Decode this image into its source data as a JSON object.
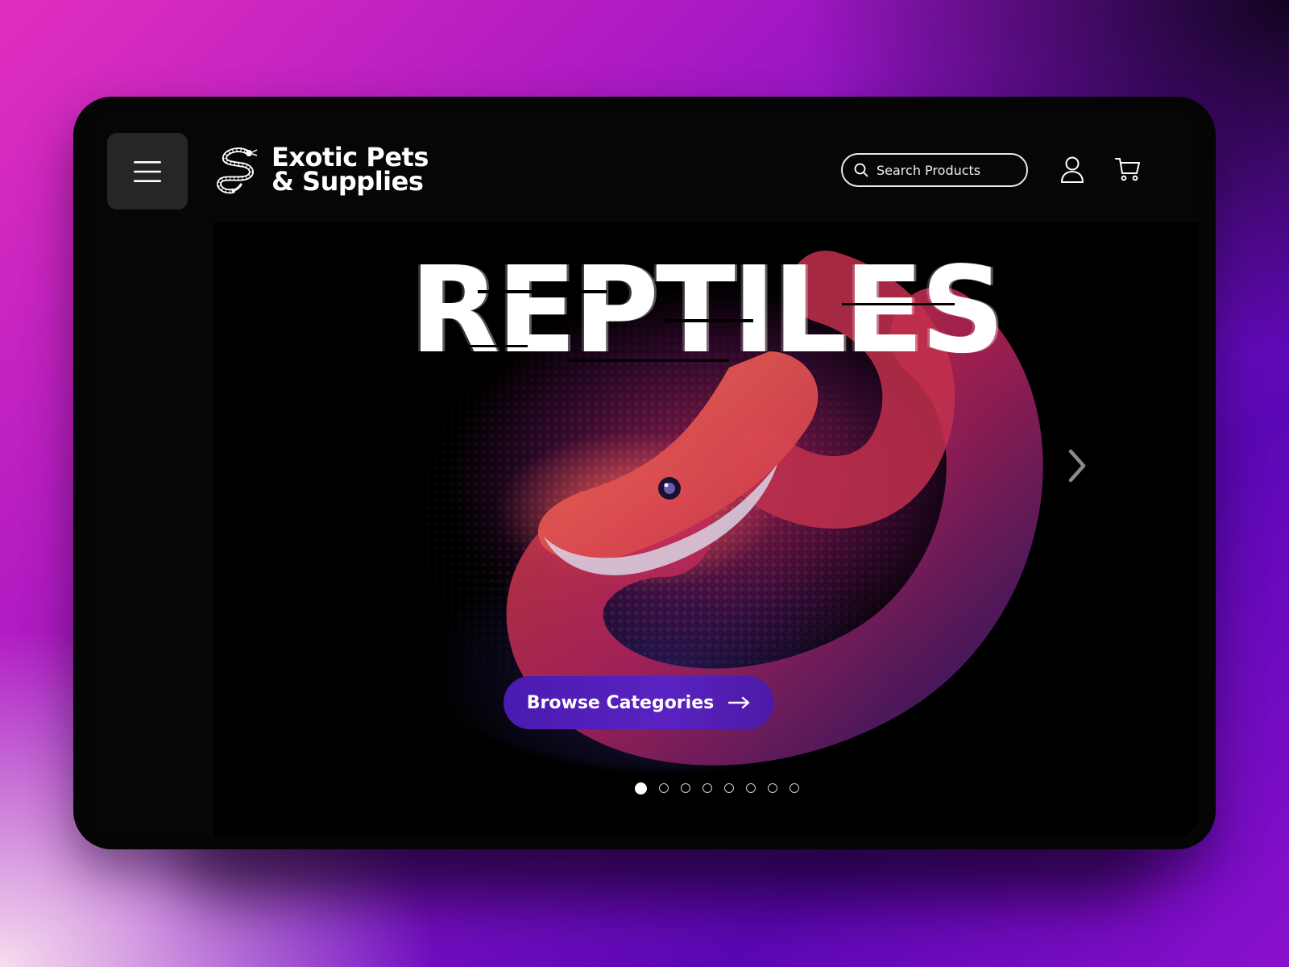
{
  "brand": {
    "line1": "Exotic Pets",
    "line2": "& Supplies",
    "logo_icon": "snake-logo-icon"
  },
  "header": {
    "menu_icon": "hamburger-menu-icon",
    "search": {
      "placeholder": "Search Products",
      "value": "",
      "icon": "search-icon"
    },
    "user_icon": "user-icon",
    "cart_icon": "cart-icon"
  },
  "hero": {
    "title": "REPTILES",
    "cta_label": "Browse Categories",
    "cta_icon": "arrow-right-icon",
    "prev_icon": "chevron-left-icon",
    "next_icon": "chevron-right-icon",
    "slide_count": 8,
    "active_slide": 1
  },
  "colors": {
    "cta": "#5322c0",
    "panel": "#000000",
    "menu_button": "#262626"
  }
}
